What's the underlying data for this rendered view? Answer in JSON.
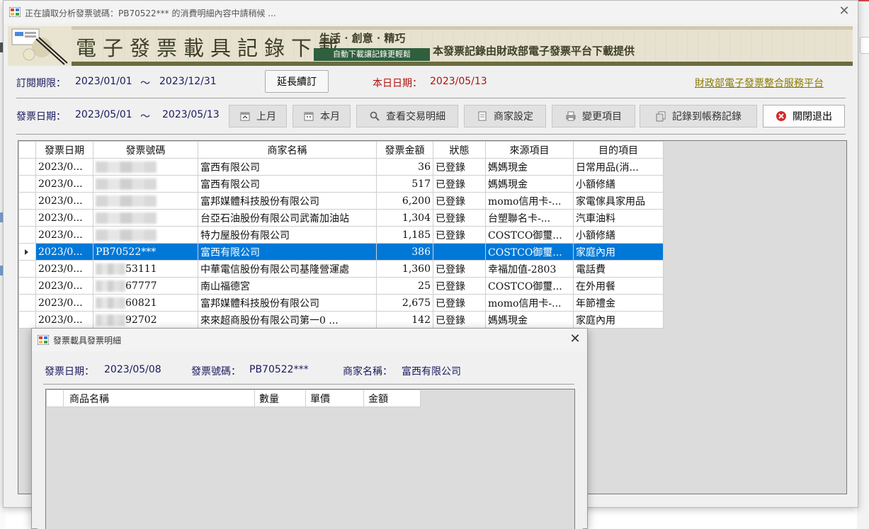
{
  "window": {
    "title": "正在讀取分析發票號碼：PB70522*** 的消費明細內容中請稍候 ..."
  },
  "banner": {
    "title": "電子發票載具記錄下載",
    "slogan": "生活 · 創意 · 精巧",
    "slogan_sub": "自動下載讓記錄更輕鬆",
    "provider": "本發票記錄由財政部電子發票平台下載提供"
  },
  "subscription": {
    "label": "訂閱期限：",
    "start": "2023/01/01",
    "tilde": "～",
    "end": "2023/12/31",
    "renew_button": "延長續訂",
    "today_label": "本日日期：",
    "today": "2023/05/13",
    "portal_link": "財政部電子發票整合服務平台"
  },
  "invoice_range": {
    "label": "發票日期：",
    "start": "2023/05/01",
    "tilde": "～",
    "end": "2023/05/13"
  },
  "toolbar": {
    "prev_month": "上月",
    "this_month": "本月",
    "view_details": "查看交易明細",
    "merchant_settings": "商家設定",
    "change_items": "變更項目",
    "record_to_ledger": "記錄到帳務記錄",
    "close_exit": "關閉退出"
  },
  "grid": {
    "columns": [
      "發票日期",
      "發票號碼",
      "商家名稱",
      "發票金額",
      "狀態",
      "來源項目",
      "目的項目"
    ],
    "rows": [
      {
        "date": "2023/0...",
        "invoice": "",
        "merchant": "富西有限公司",
        "amount": "36",
        "status": "已登錄",
        "source": "媽媽現金",
        "target": "日常用品(消..."
      },
      {
        "date": "2023/0...",
        "invoice": "",
        "merchant": "富西有限公司",
        "amount": "517",
        "status": "已登錄",
        "source": "媽媽現金",
        "target": "小額修繕"
      },
      {
        "date": "2023/0...",
        "invoice": "",
        "merchant": "富邦媒體科技股份有限公司",
        "amount": "6,200",
        "status": "已登錄",
        "source": "momo信用卡-...",
        "target": "家電傢具家用品"
      },
      {
        "date": "2023/0...",
        "invoice": "",
        "merchant": "台亞石油股份有限公司武崙加油站",
        "amount": "1,304",
        "status": "已登錄",
        "source": "台塑聯名卡-...",
        "target": "汽車油料"
      },
      {
        "date": "2023/0...",
        "invoice": "",
        "merchant": "特力屋股份有限公司",
        "amount": "1,185",
        "status": "已登錄",
        "source": "COSTCO御璽...",
        "target": "小額修繕"
      },
      {
        "date": "2023/0...",
        "invoice": "PB70522***",
        "merchant": "富西有限公司",
        "amount": "386",
        "status": "",
        "source": "COSTCO御璽...",
        "target": "家庭內用"
      },
      {
        "date": "2023/0...",
        "invoice": "53111",
        "merchant": "中華電信股份有限公司基隆營運處",
        "amount": "1,360",
        "status": "已登錄",
        "source": "幸福加值-2803",
        "target": "電話費"
      },
      {
        "date": "2023/0...",
        "invoice": "67777",
        "merchant": "南山福德宮",
        "amount": "25",
        "status": "已登錄",
        "source": "COSTCO御璽...",
        "target": "在外用餐"
      },
      {
        "date": "2023/0...",
        "invoice": "60821",
        "merchant": "富邦媒體科技股份有限公司",
        "amount": "2,675",
        "status": "已登錄",
        "source": "momo信用卡-...",
        "target": "年節禮金"
      },
      {
        "date": "2023/0...",
        "invoice": "92702",
        "merchant": "來來超商股份有限公司第一0 ...",
        "amount": "142",
        "status": "已登錄",
        "source": "媽媽現金",
        "target": "家庭內用"
      }
    ]
  },
  "dialog": {
    "title": "發票載具發票明細",
    "date_label": "發票日期：",
    "date": "2023/05/08",
    "invoice_label": "發票號碼：",
    "invoice": "PB70522***",
    "merchant_label": "商家名稱：",
    "merchant": "富西有限公司",
    "columns": [
      "商品名稱",
      "數量",
      "單價",
      "金額"
    ]
  }
}
